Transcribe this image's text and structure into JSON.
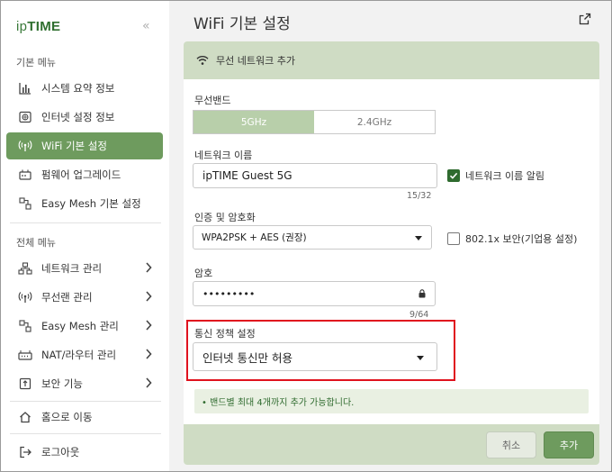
{
  "sidebar": {
    "logo_prefix": "ip",
    "logo_main": "TIME",
    "collapse_glyph": "«",
    "section_basic": "기본 메뉴",
    "basic_items": [
      {
        "label": "시스템 요약 정보",
        "icon": "bar-chart-icon"
      },
      {
        "label": "인터넷 설정 정보",
        "icon": "globe-icon"
      },
      {
        "label": "WiFi 기본 설정",
        "icon": "wifi-antenna-icon",
        "active": true
      },
      {
        "label": "펌웨어 업그레이드",
        "icon": "router-icon"
      },
      {
        "label": "Easy Mesh 기본 설정",
        "icon": "mesh-icon"
      }
    ],
    "section_all": "전체 메뉴",
    "all_items": [
      {
        "label": "네트워크 관리",
        "icon": "network-icon"
      },
      {
        "label": "무선랜 관리",
        "icon": "wifi-antenna-icon"
      },
      {
        "label": "Easy Mesh 관리",
        "icon": "mesh-icon"
      },
      {
        "label": "NAT/라우터 관리",
        "icon": "router-icon"
      },
      {
        "label": "보안 기능",
        "icon": "lock-icon"
      }
    ],
    "home_label": "홈으로 이동",
    "logout_label": "로그아웃"
  },
  "main": {
    "title": "WiFi 기본 설정",
    "panel_title": "무선 네트워크 추가",
    "band_label": "무선밴드",
    "band_options": [
      "5GHz",
      "2.4GHz"
    ],
    "band_selected": "5GHz",
    "ssid_label": "네트워크 이름",
    "ssid_value": "ipTIME Guest 5G",
    "ssid_counter": "15/32",
    "ssid_broadcast_label": "네트워크 이름 알림",
    "ssid_broadcast_checked": true,
    "auth_label": "인증 및 암호화",
    "auth_value": "WPA2PSK + AES (권장)",
    "enterprise_label": "802.1x 보안(기업용 설정)",
    "enterprise_checked": false,
    "password_label": "암호",
    "password_value": "•••••••••",
    "password_counter": "9/64",
    "policy_label": "통신 정책 설정",
    "policy_value": "인터넷 통신만 허용",
    "notice": "• 밴드별 최대 4개까지 추가 가능합니다.",
    "cancel_label": "취소",
    "add_label": "추가"
  },
  "colors": {
    "accent": "#6e9b5e",
    "panel_header": "#cfdcc4",
    "highlight_border": "#e0121e"
  }
}
